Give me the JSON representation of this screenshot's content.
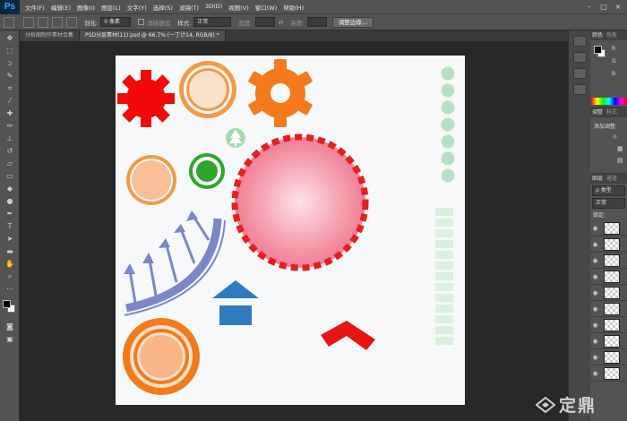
{
  "app": {
    "logo": "Ps",
    "menu": [
      "文件(F)",
      "编辑(E)",
      "图像(I)",
      "图层(L)",
      "文字(Y)",
      "选择(S)",
      "滤镜(T)",
      "3D(D)",
      "视图(V)",
      "窗口(W)",
      "帮助(H)"
    ]
  },
  "options": {
    "feather_label": "羽化:",
    "feather_value": "0 像素",
    "antialias_label": "消除锯齿",
    "style_label": "样式:",
    "style_value": "正常",
    "width_label": "宽度:",
    "height_label": "高度:",
    "refine_edge_button": "调整边缘..."
  },
  "tabs": [
    {
      "label": "分析图制作素材合集",
      "active": false
    },
    {
      "label": "PSD分层素材(11).psd @ 66.7% (一丁计14, RGB/8) *",
      "active": true
    }
  ],
  "panels": {
    "color_tab": "颜色",
    "swatches_tab": "色板",
    "channel_r": "R",
    "channel_g": "G",
    "channel_b": "B",
    "adjustments_tab": "调整",
    "styles_tab": "样式",
    "add_adjustment_label": "添加调整",
    "layers_tab": "图层",
    "channels_tab": "通道",
    "kind_filter": "ρ 类型",
    "blend_mode": "正常",
    "lock_label": "锁定:"
  },
  "layers": [
    {
      "visible": true
    },
    {
      "visible": true
    },
    {
      "visible": true
    },
    {
      "visible": true
    },
    {
      "visible": true
    },
    {
      "visible": true
    },
    {
      "visible": true
    },
    {
      "visible": true
    },
    {
      "visible": true
    },
    {
      "visible": true
    }
  ],
  "watermark": {
    "text": "定鼎"
  },
  "colors": {
    "gear_red": "#f20a0a",
    "gear_orange": "#f47a1b",
    "peach_ring": "#f39a45",
    "peach_fill": "#fbe2cc",
    "green_ring": "#2fa52f",
    "pale_green": "#b9e0c3",
    "dashed_red": "#e51e1e",
    "arc_blue": "#7b87c9",
    "house_blue": "#2f7bbd"
  }
}
